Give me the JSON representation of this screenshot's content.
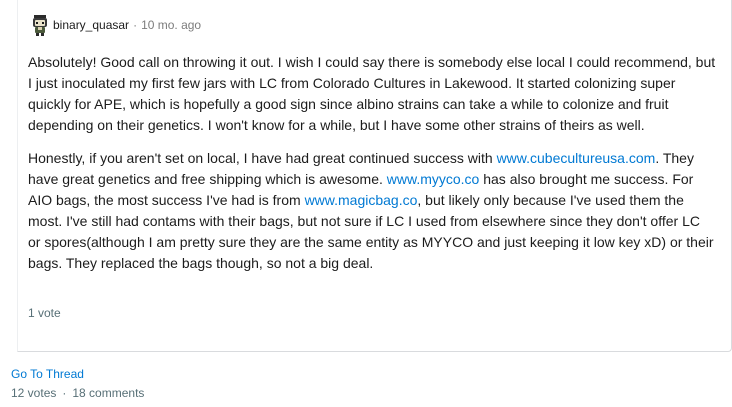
{
  "comment": {
    "username": "binary_quasar",
    "separator": "·",
    "timestamp": "10 mo. ago",
    "paragraphs": [
      [
        {
          "text": "Absolutely! Good call on throwing it out. I wish I could say there is somebody else local I could recommend, but I just inoculated my first few jars with LC from Colorado Cultures in Lakewood. It started colonizing super quickly for APE, which is hopefully a good sign since albino strains can take a while to colonize and fruit depending on their genetics. I won't know for a while, but I have some other strains of theirs as well.",
          "link": false
        }
      ],
      [
        {
          "text": "Honestly, if you aren't set on local, I have had great continued success with ",
          "link": false
        },
        {
          "text": "www.cubecultureusa.com",
          "link": true
        },
        {
          "text": ". They have great genetics and free shipping which is awesome. ",
          "link": false
        },
        {
          "text": "www.myyco.co",
          "link": true
        },
        {
          "text": " has also brought me success. For AIO bags, the most success I've had is from ",
          "link": false
        },
        {
          "text": "www.magicbag.co",
          "link": true
        },
        {
          "text": ", but likely only because I've used them the most. I've still had contams with their bags, but not sure if LC I used from elsewhere since they don't offer LC or spores(although I am pretty sure they are the same entity as MYYCO and just keeping it low key xD) or their bags. They replaced the bags though, so not a big deal.",
          "link": false
        }
      ]
    ],
    "votes": "1 vote"
  },
  "thread": {
    "goto_label": "Go To Thread",
    "votes": "12 votes",
    "separator": "·",
    "comments": "18 comments"
  },
  "colors": {
    "link": "#0079d3",
    "meta": "#576f76",
    "text": "#1c1c1c"
  },
  "icons": {
    "avatar": "snoo-avatar-icon"
  }
}
